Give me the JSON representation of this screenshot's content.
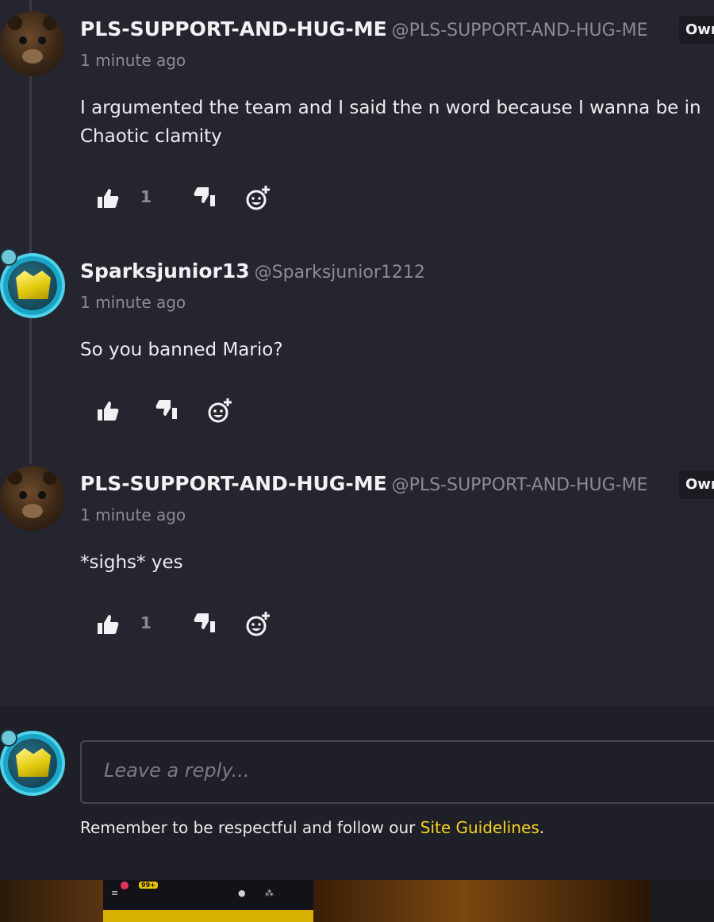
{
  "comments": [
    {
      "name": "PLS-SUPPORT-AND-HUG-ME",
      "handle": "@PLS-SUPPORT-AND-HUG-ME",
      "badge": "Owner",
      "time": "1 minute ago",
      "text": "I argumented the team and I said the n word because I wanna be in Chaotic clamity",
      "likes": "1",
      "avatar": "bear-avatar"
    },
    {
      "name": "Sparksjunior13",
      "handle": "@Sparksjunior1212",
      "time": "1 minute ago",
      "text": "So you banned Mario?",
      "likes": "",
      "avatar": "crown-avatar"
    },
    {
      "name": "PLS-SUPPORT-AND-HUG-ME",
      "handle": "@PLS-SUPPORT-AND-HUG-ME",
      "badge": "Owner",
      "time": "1 minute ago",
      "text": "*sighs* yes",
      "likes": "1",
      "avatar": "bear-avatar"
    }
  ],
  "reply": {
    "placeholder": "Leave a reply...",
    "guidelines_prefix": "Remember to be respectful and follow our ",
    "guidelines_link": "Site Guidelines",
    "guidelines_suffix": "."
  },
  "taskbar": {
    "notification_count": "99+"
  },
  "colors": {
    "background": "#25252f",
    "reply_area": "#1f1f27",
    "link": "#f5d320",
    "muted_text": "#8b8b96"
  }
}
